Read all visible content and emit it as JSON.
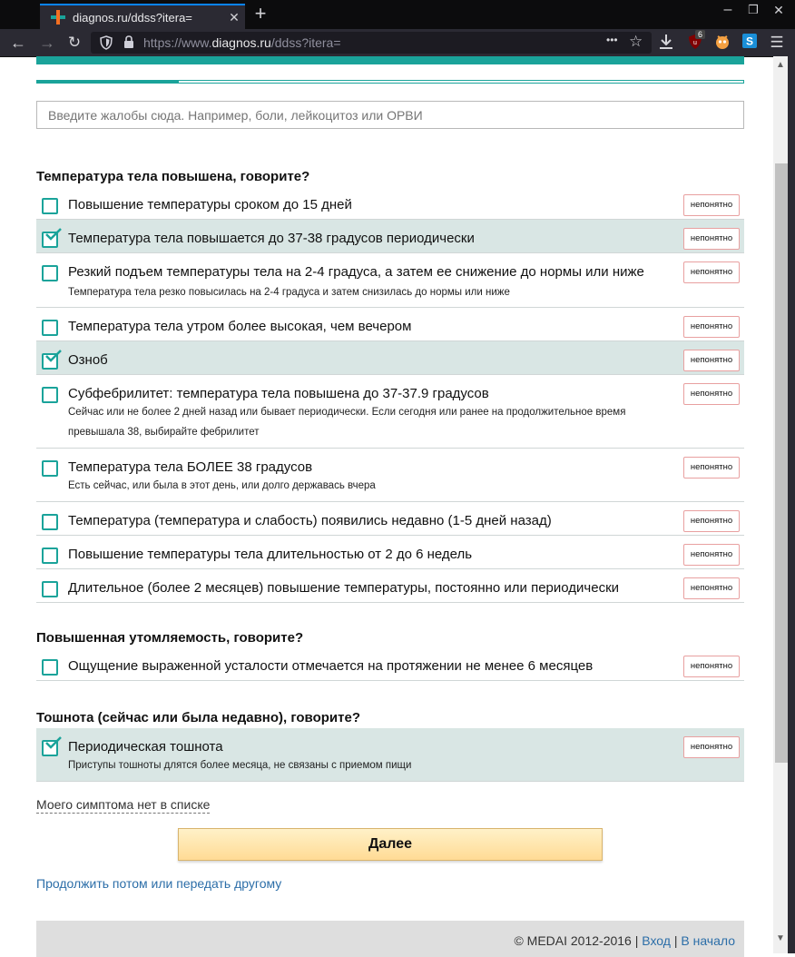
{
  "browser": {
    "tab_title": "diagnos.ru/ddss?itera=",
    "new_tab": "+",
    "minimize": "–",
    "maximize": "❐",
    "close": "✕",
    "url_prefix": "https://www.",
    "url_domain": "diagnos.ru",
    "url_path": "/ddss?itera=",
    "ublock_count": "6",
    "page_actions": "•••"
  },
  "page": {
    "progress_fraction": 0.2,
    "search_placeholder": "Введите жалобы сюда. Например, боли, лейкоцитоз или ОРВИ",
    "unclear_label": "непонятно",
    "sections": [
      {
        "title": "Температура тела повышена, говорите?",
        "items": [
          {
            "label": "Повышение температуры сроком до 15 дней",
            "sub": "",
            "checked": false
          },
          {
            "label": "Температура тела повышается до 37-38 градусов периодически",
            "sub": "",
            "checked": true
          },
          {
            "label": "Резкий подъем температуры тела на 2-4 градуса, а затем ее снижение до нормы или ниже",
            "sub": "Температура тела резко повысилась на 2-4 градуса и затем снизилась до нормы или ниже",
            "checked": false
          },
          {
            "label": "Температура тела утром более высокая, чем вечером",
            "sub": "",
            "checked": false
          },
          {
            "label": "Озноб",
            "sub": "",
            "checked": true
          },
          {
            "label": "Субфебрилитет: температура тела повышена до 37-37.9 градусов",
            "sub": "Сейчас или не более 2 дней назад или бывает периодически. Если сегодня или ранее на продолжительное время превышала 38, выбирайте фебрилитет",
            "checked": false
          },
          {
            "label": "Температура тела БОЛЕЕ 38 градусов",
            "sub": "Есть сейчас, или была в этот день, или долго державась вчера",
            "checked": false
          },
          {
            "label": "Температура (температура и слабость) появились недавно (1-5 дней назад)",
            "sub": "",
            "checked": false
          },
          {
            "label": "Повышение температуры тела длительностью от 2 до 6 недель",
            "sub": "",
            "checked": false
          },
          {
            "label": "Длительное (более 2 месяцев) повышение температуры, постоянно или периодически",
            "sub": "",
            "checked": false
          }
        ]
      },
      {
        "title": "Повышенная утомляемость, говорите?",
        "items": [
          {
            "label": "Ощущение выраженной усталости отмечается на протяжении не менее 6 месяцев",
            "sub": "",
            "checked": false
          }
        ]
      },
      {
        "title": "Тошнота (сейчас или была недавно), говорите?",
        "items": [
          {
            "label": "Периодическая тошнота",
            "sub": "Приступы тошноты длятся более месяца, не связаны с приемом пищи",
            "checked": true
          }
        ]
      }
    ],
    "no_symptom_link": "Моего симптома нет в списке",
    "next_button": "Далее",
    "continue_link": "Продолжить потом или передать другому",
    "footer_copyright": "© MEDAI 2012-2016 |",
    "footer_login": "Вход",
    "footer_separator": "|",
    "footer_home": "В начало"
  }
}
